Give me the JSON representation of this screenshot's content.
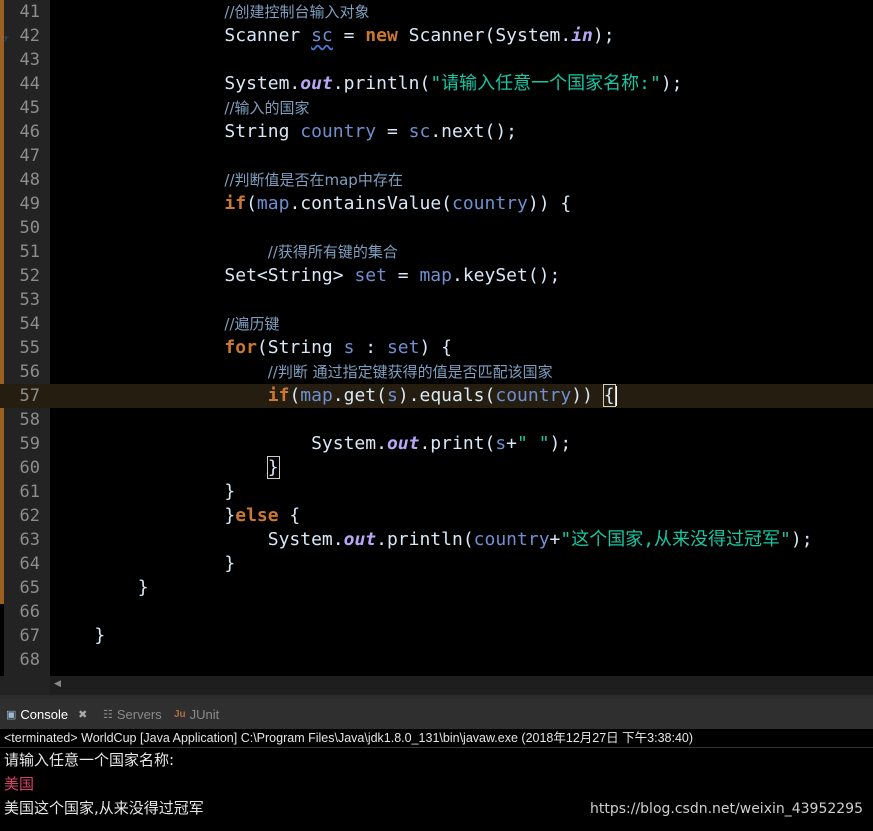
{
  "editor": {
    "lines": [
      {
        "num": "41",
        "code": "                //创建控制台输入对象"
      },
      {
        "num": "42",
        "code": "                Scanner sc = new Scanner(System.in);"
      },
      {
        "num": "43",
        "code": ""
      },
      {
        "num": "44",
        "code": "                System.out.println(\"请输入任意一个国家名称:\");"
      },
      {
        "num": "45",
        "code": "                //输入的国家"
      },
      {
        "num": "46",
        "code": "                String country = sc.next();"
      },
      {
        "num": "47",
        "code": ""
      },
      {
        "num": "48",
        "code": "                //判断值是否在map中存在"
      },
      {
        "num": "49",
        "code": "                if(map.containsValue(country)) {"
      },
      {
        "num": "50",
        "code": ""
      },
      {
        "num": "51",
        "code": "                    //获得所有键的集合"
      },
      {
        "num": "52",
        "code": "                Set<String> set = map.keySet();"
      },
      {
        "num": "53",
        "code": ""
      },
      {
        "num": "54",
        "code": "                //遍历键"
      },
      {
        "num": "55",
        "code": "                for(String s : set) {"
      },
      {
        "num": "56",
        "code": "                    //判断 通过指定键获得的值是否匹配该国家"
      },
      {
        "num": "57",
        "code": "                    if(map.get(s).equals(country)) {"
      },
      {
        "num": "58",
        "code": ""
      },
      {
        "num": "59",
        "code": "                        System.out.print(s+\" \");"
      },
      {
        "num": "60",
        "code": "                    }"
      },
      {
        "num": "61",
        "code": "                }"
      },
      {
        "num": "62",
        "code": "                }else {"
      },
      {
        "num": "63",
        "code": "                    System.out.println(country+\"这个国家,从来没得过冠军\");"
      },
      {
        "num": "64",
        "code": "                }"
      },
      {
        "num": "65",
        "code": "        }"
      },
      {
        "num": "66",
        "code": ""
      },
      {
        "num": "67",
        "code": "    }"
      },
      {
        "num": "68",
        "code": ""
      }
    ]
  },
  "tabs": {
    "console": "Console",
    "servers": "Servers",
    "junit": "JUnit"
  },
  "console": {
    "terminated": "<terminated> WorldCup [Java Application] C:\\Program Files\\Java\\jdk1.8.0_131\\bin\\javaw.exe (2018年12月27日 下午3:38:40)",
    "output_1": "请输入任意一个国家名称:",
    "output_2": "美国",
    "output_3": "美国这个国家,从来没得过冠军"
  },
  "watermark": "https://blog.csdn.net/weixin_43952295",
  "colors": {
    "keyword": "#cc7832",
    "field": "#6f8fd1",
    "static_field": "#b9a6f6",
    "string": "#17c6a3",
    "comment": "#7f9fbf",
    "console_input": "#d8406c"
  }
}
